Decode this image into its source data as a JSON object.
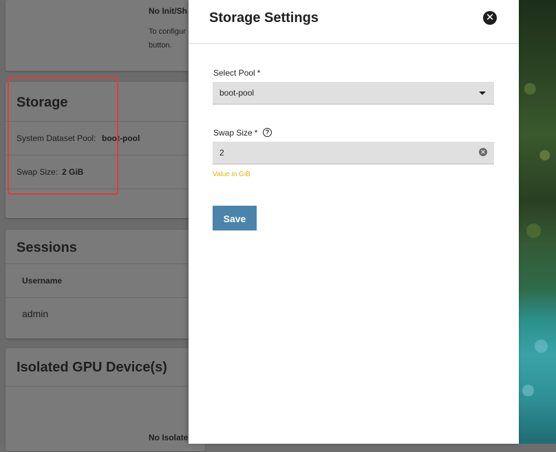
{
  "background": {
    "top_card": {
      "heading": "No Init/Sh",
      "text_line1": "To configur",
      "text_line2": "button."
    },
    "storage_card": {
      "title": "Storage",
      "pool_label": "System Dataset Pool:",
      "pool_value": "boot-pool",
      "swap_label": "Swap Size:",
      "swap_value": "2 GiB"
    },
    "sessions_card": {
      "title": "Sessions",
      "column_username": "Username",
      "rows": [
        "admin"
      ]
    },
    "gpu_card": {
      "title": "Isolated GPU Device(s)",
      "empty_text": "No Isolate"
    }
  },
  "panel": {
    "title": "Storage Settings",
    "pool_field": {
      "label": "Select Pool",
      "required_mark": "*",
      "value": "boot-pool"
    },
    "swap_field": {
      "label": "Swap Size",
      "required_mark": "*",
      "value": "2",
      "hint": "Value in GiB"
    },
    "save_label": "Save"
  },
  "colors": {
    "accent": "#4a84aa",
    "highlight_border": "#e53b2c",
    "hint": "#e2b400"
  }
}
